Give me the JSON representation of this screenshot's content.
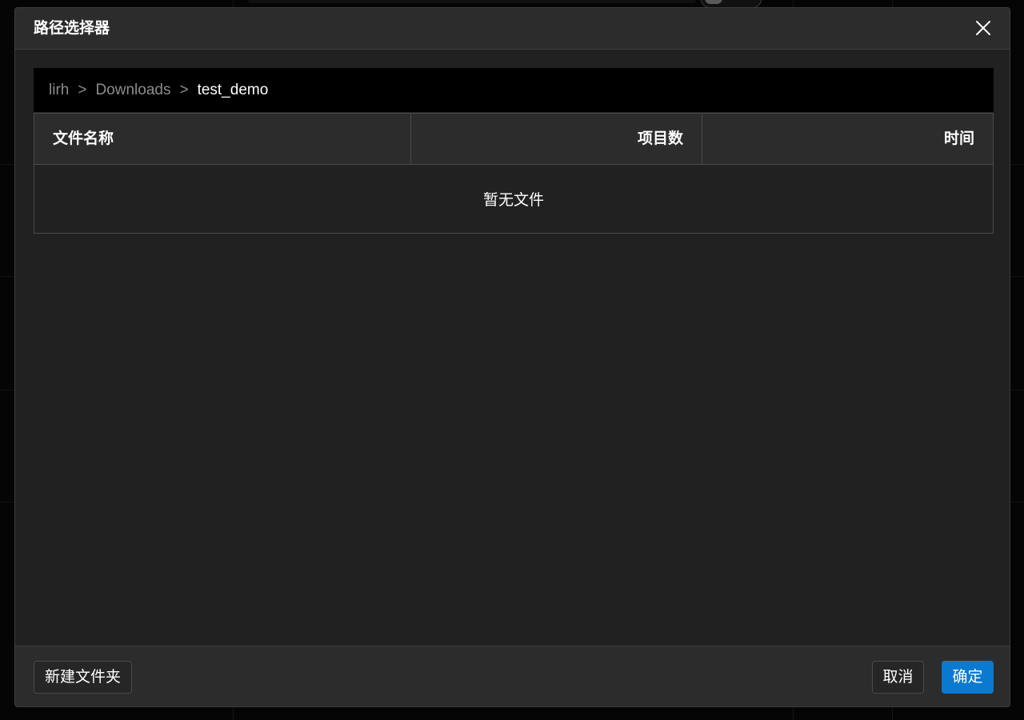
{
  "dialog": {
    "title": "路径选择器",
    "close_icon": "close-icon"
  },
  "breadcrumb": {
    "items": [
      "lirh",
      "Downloads",
      "test_demo"
    ],
    "separator": ">"
  },
  "table": {
    "columns": [
      "文件名称",
      "项目数",
      "时间"
    ],
    "rows": [],
    "empty_text": "暂无文件"
  },
  "footer": {
    "new_folder_label": "新建文件夹",
    "cancel_label": "取消",
    "confirm_label": "确定"
  },
  "colors": {
    "accent": "#0a7ad1",
    "dialog_bg": "#212121",
    "header_bg": "#2c2c2c",
    "breadcrumb_bg": "#000000"
  }
}
